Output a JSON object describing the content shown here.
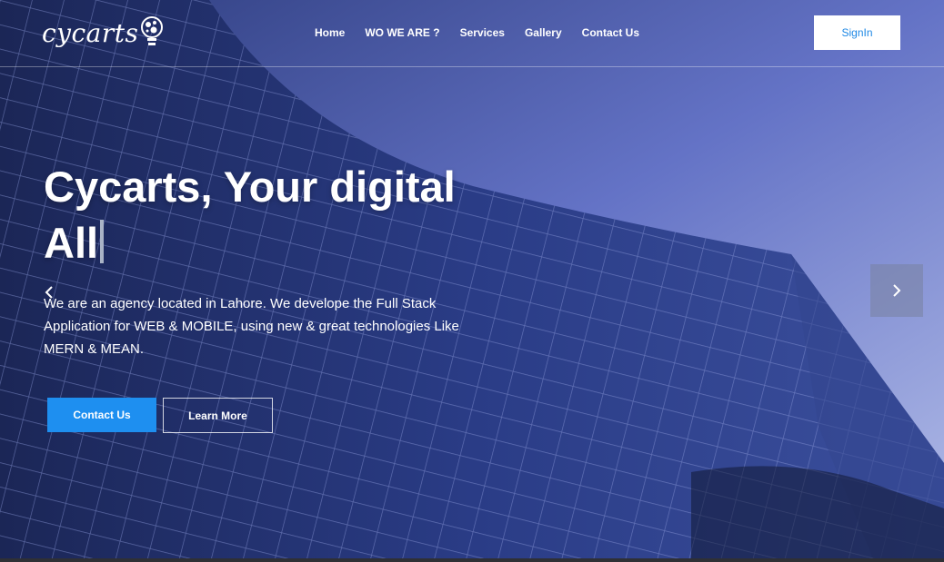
{
  "brand": {
    "name": "cycarts",
    "logo_icon": "lightbulb-gear-icon"
  },
  "nav": {
    "items": [
      {
        "label": "Home"
      },
      {
        "label": "WO WE ARE ?"
      },
      {
        "label": "Services"
      },
      {
        "label": "Gallery"
      },
      {
        "label": "Contact Us"
      }
    ],
    "signin_label": "SignIn"
  },
  "hero": {
    "headline_line1": "Cycarts, Your digital",
    "headline_line2": "All",
    "description": "We are an agency located in Lahore. We develope the Full Stack Application for WEB & MOBILE, using new & great technologies Like MERN & MEAN.",
    "primary_button": "Contact Us",
    "secondary_button": "Learn More",
    "prev_icon": "chevron-left-icon",
    "next_icon": "chevron-right-icon"
  },
  "colors": {
    "accent": "#1e8ff0",
    "signin_text": "#1e88e5"
  }
}
